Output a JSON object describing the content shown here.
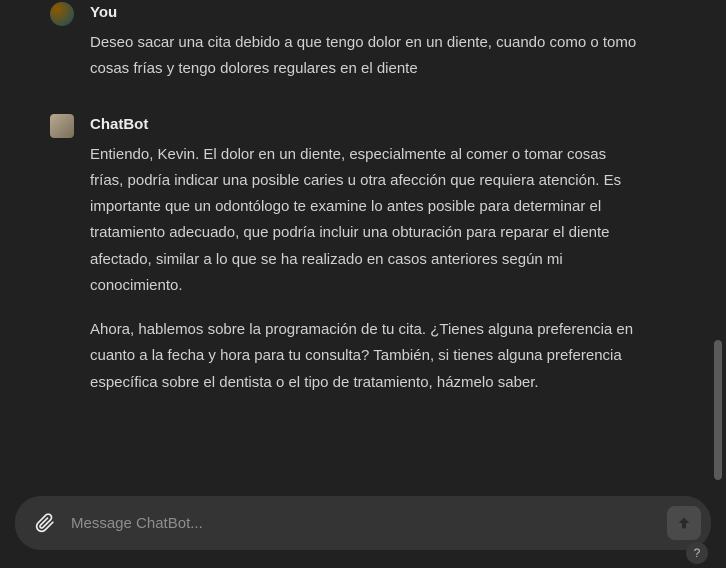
{
  "messages": [
    {
      "sender": "You",
      "avatar_type": "user",
      "paragraphs": [
        "Deseo sacar una cita debido a que tengo dolor en un diente, cuando como o tomo cosas frías y tengo dolores regulares en el diente"
      ]
    },
    {
      "sender": "ChatBot",
      "avatar_type": "bot",
      "paragraphs": [
        "Entiendo, Kevin. El dolor en un diente, especialmente al comer o tomar cosas frías, podría indicar una posible caries u otra afección que requiera atención. Es importante que un odontólogo te examine lo antes posible para determinar el tratamiento adecuado, que podría incluir una obturación para reparar el diente afectado, similar a lo que se ha realizado en casos anteriores según mi conocimiento.",
        "Ahora, hablemos sobre la programación de tu cita. ¿Tienes alguna preferencia en cuanto a la fecha y hora para tu consulta? También, si tienes alguna preferencia específica sobre el dentista o el tipo de tratamiento, házmelo saber."
      ]
    }
  ],
  "input": {
    "placeholder": "Message ChatBot...",
    "value": ""
  },
  "help_badge": "?",
  "colors": {
    "background": "#212121",
    "text_primary": "#ececec",
    "text_secondary": "#d1d1d1",
    "input_bg": "#343434",
    "placeholder": "#8e8e8e",
    "send_bg": "#4a4a4a"
  }
}
